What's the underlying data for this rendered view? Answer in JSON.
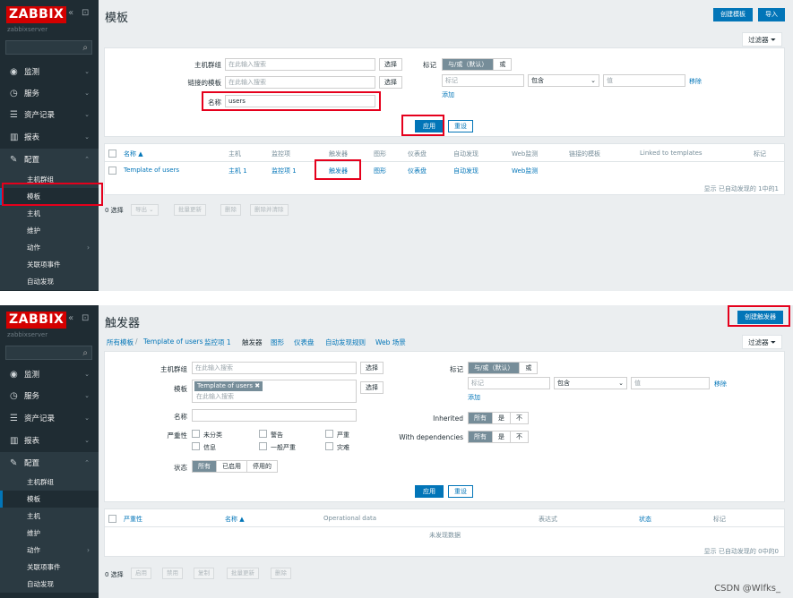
{
  "sidebar": {
    "logo": "ZABBIX",
    "server": "zabbixserver",
    "menu": [
      {
        "label": "监测"
      },
      {
        "label": "服务"
      },
      {
        "label": "资产记录"
      },
      {
        "label": "报表"
      },
      {
        "label": "配置"
      }
    ],
    "sub": [
      {
        "label": "主机群组"
      },
      {
        "label": "模板"
      },
      {
        "label": "主机"
      },
      {
        "label": "维护"
      },
      {
        "label": "动作"
      },
      {
        "label": "关联项事件"
      },
      {
        "label": "自动发现"
      }
    ]
  },
  "screen1": {
    "title": "模板",
    "btn_create": "创建模板",
    "btn_import": "导入",
    "filter_tab": "过滤器",
    "filter": {
      "host_groups_label": "主机群组",
      "linked_label": "链接的模板",
      "name_label": "名称",
      "placeholder": "在此输入搜索",
      "select": "选择",
      "name_value": "users",
      "tags_label": "标记",
      "tag_or": "与/或（默认）",
      "tag_or2": "或",
      "tag_ph": "标记",
      "contains": "包含",
      "value_ph": "值",
      "remove": "移除",
      "add": "添加",
      "apply": "应用",
      "reset": "重设"
    },
    "columns": [
      "名称 ▲",
      "主机",
      "监控项",
      "触发器",
      "图形",
      "仪表盘",
      "自动发现",
      "Web监测",
      "链接的模板",
      "Linked to templates",
      "标记"
    ],
    "row": {
      "name": "Template of users",
      "hosts": "主机 1",
      "items": "监控项 1",
      "triggers": "触发器",
      "graphs": "图形",
      "dashboards": "仪表盘",
      "discovery": "自动发现",
      "web": "Web监测"
    },
    "footer": "显示 已自动发现的 1中的1",
    "mass": {
      "selected": "0 选择",
      "export": "导出",
      "mass_update": "批量更新",
      "delete": "删除",
      "delete_clear": "删除并清除"
    }
  },
  "screen2": {
    "title": "触发器",
    "btn_create": "创建触发器",
    "filter_tab": "过滤器",
    "crumbs": [
      "所有模板",
      "Template of users",
      "监控项 1",
      "触发器",
      "图形",
      "仪表盘",
      "自动发现规则",
      "Web 场景"
    ],
    "filter": {
      "host_groups_label": "主机群组",
      "template_label": "模板",
      "template_chip": "Template of users ✖",
      "placeholder": "在此输入搜索",
      "select": "选择",
      "name_label": "名称",
      "severity_label": "严重性",
      "severities": [
        "未分类",
        "警告",
        "严重",
        "信息",
        "一般严重",
        "灾难"
      ],
      "status_label": "状态",
      "status_opts": [
        "所有",
        "已启用",
        "停用的"
      ],
      "tags_label": "标记",
      "tag_or": "与/或（默认）",
      "tag_or2": "或",
      "tag_ph": "标记",
      "contains": "包含",
      "value_ph": "值",
      "remove": "移除",
      "add": "添加",
      "inherited_label": "Inherited",
      "dep_label": "With dependencies",
      "tri": [
        "所有",
        "是",
        "不"
      ],
      "apply": "应用",
      "reset": "重设"
    },
    "columns": [
      "严重性",
      "名称 ▲",
      "Operational data",
      "表达式",
      "状态",
      "标记"
    ],
    "nodata": "未发现数据",
    "footer": "显示 已自动发现的 0中的0",
    "mass": {
      "selected": "0 选择",
      "enable": "启用",
      "disable": "禁用",
      "copy": "复制",
      "mass_update": "批量更新",
      "delete": "删除"
    }
  },
  "watermark": "CSDN @Wlfks_"
}
